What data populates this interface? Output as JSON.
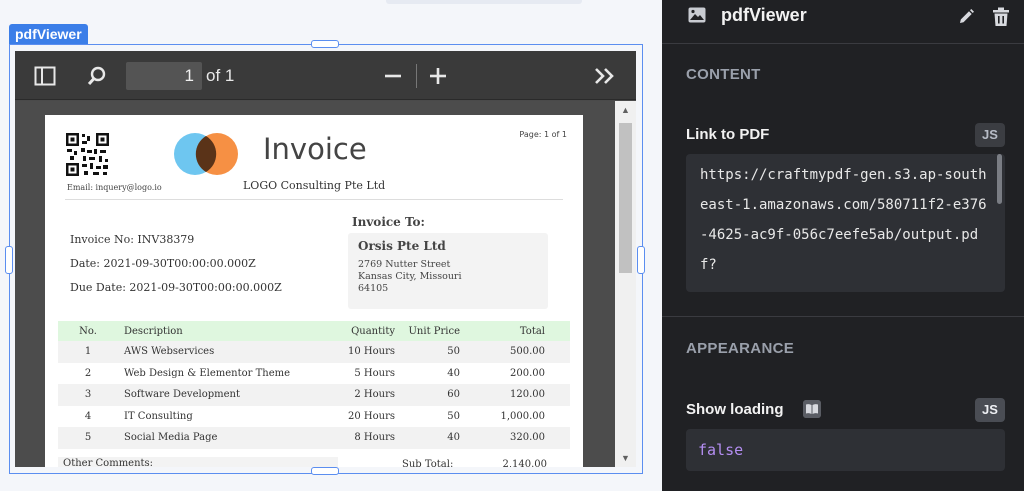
{
  "widget": {
    "name": "pdfViewer"
  },
  "viewer": {
    "page_current": "1",
    "page_of": "of 1",
    "icons": [
      "sidebar-icon",
      "search-icon",
      "zoom-out-icon",
      "zoom-in-icon",
      "more-tools-icon"
    ]
  },
  "invoice": {
    "title": "Invoice",
    "page_label": "Page: 1 of 1",
    "email": "Email: inquery@logo.io",
    "company": "LOGO Consulting Pte Ltd",
    "invoice_no": "Invoice No: INV38379",
    "date": "Date: 2021-09-30T00:00:00.000Z",
    "due_date": "Due Date: 2021-09-30T00:00:00.000Z",
    "to_title": "Invoice To:",
    "to_name": "Orsis Pte Ltd",
    "to_address": [
      "2769 Nutter Street",
      "Kansas City, Missouri",
      "64105"
    ],
    "columns": {
      "no": "No.",
      "desc": "Description",
      "qty": "Quantity",
      "unit": "Unit Price",
      "total": "Total"
    },
    "items": [
      {
        "no": "1",
        "desc": "AWS Webservices",
        "qty": "10 Hours",
        "unit": "50",
        "total": "500.00"
      },
      {
        "no": "2",
        "desc": "Web Design & Elementor Theme",
        "qty": "5 Hours",
        "unit": "40",
        "total": "200.00"
      },
      {
        "no": "3",
        "desc": "Software Development",
        "qty": "2 Hours",
        "unit": "60",
        "total": "120.00"
      },
      {
        "no": "4",
        "desc": "IT Consulting",
        "qty": "20 Hours",
        "unit": "50",
        "total": "1,000.00"
      },
      {
        "no": "5",
        "desc": "Social Media Page",
        "qty": "8 Hours",
        "unit": "40",
        "total": "320.00"
      }
    ],
    "other_comments": "Other Comments:",
    "sub_total_label": "Sub Total:",
    "sub_total_value": "2,140.00"
  },
  "panel": {
    "title": "pdfViewer",
    "content_section": "CONTENT",
    "link_label": "Link to PDF",
    "link_value": "https://craftmypdf-gen.s3.ap-southeast-1.amazonaws.com/580711f2-e376-4625-ac9f-056c7eefe5ab/output.pdf?",
    "js_label": "JS",
    "appearance_section": "APPEARANCE",
    "show_loading_label": "Show loading",
    "show_loading_value": "false"
  },
  "colors": {
    "accent": "#3b7ee8",
    "panel_bg": "#202124",
    "bool_value": "#b48ef2",
    "table_header": "#dff7df",
    "logo_blue": "#6ec6f0",
    "logo_orange": "#f58a3a"
  }
}
